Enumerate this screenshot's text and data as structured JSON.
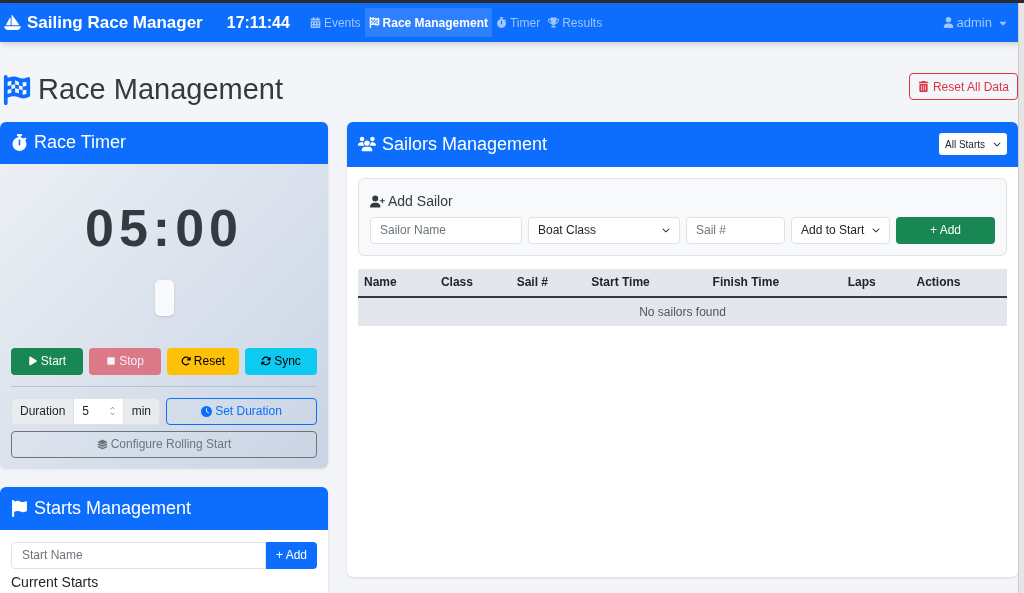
{
  "navbar": {
    "brand": "Sailing Race Manager",
    "clock": "17:11:44",
    "items": [
      {
        "label": "Events",
        "selected": false
      },
      {
        "label": "Race Management",
        "selected": true
      },
      {
        "label": "Timer",
        "selected": false
      },
      {
        "label": "Results",
        "selected": false
      }
    ],
    "user": "admin"
  },
  "page": {
    "title": "Race Management",
    "reset_button": "Reset All Data"
  },
  "race_timer": {
    "title": "Race Timer",
    "display": "05:00",
    "buttons": [
      {
        "label": "Start",
        "kind": "start",
        "disabled": false
      },
      {
        "label": "Stop",
        "kind": "stop",
        "disabled": true
      },
      {
        "label": "Reset",
        "kind": "reset",
        "disabled": false
      },
      {
        "label": "Sync",
        "kind": "sync",
        "disabled": false
      }
    ],
    "duration": {
      "label": "Duration",
      "value": "5",
      "unit": "min",
      "button": "Set Duration"
    },
    "rolling_start_button": "Configure Rolling Start"
  },
  "starts_management": {
    "title": "Starts Management",
    "placeholder": "Start Name",
    "add_button": "+ Add",
    "section_title": "Current Starts"
  },
  "sailors_management": {
    "title": "Sailors Management",
    "filter": "All Starts",
    "add_sailor": {
      "title": "Add Sailor",
      "name_placeholder": "Sailor Name",
      "class_select": "Boat Class",
      "sail_placeholder": "Sail #",
      "start_select": "Add to Start",
      "add_button": "+ Add"
    },
    "table": {
      "columns": [
        "Name",
        "Class",
        "Sail #",
        "Start Time",
        "Finish Time",
        "Laps",
        "Actions"
      ],
      "empty_message": "No sailors found"
    }
  }
}
